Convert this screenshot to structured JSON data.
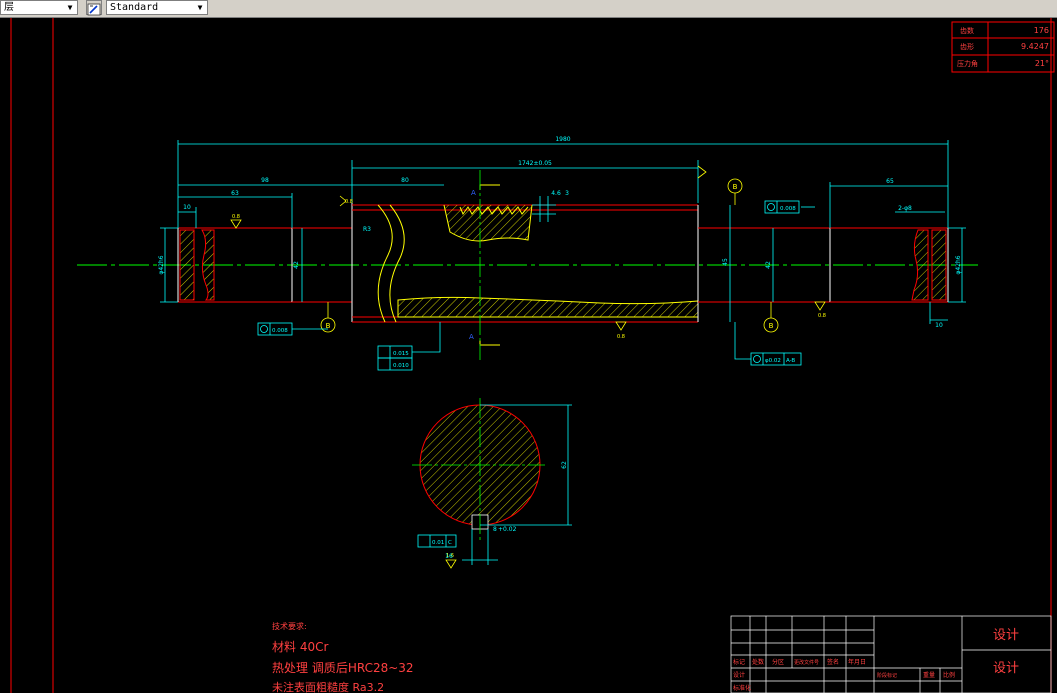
{
  "toolbar": {
    "layer_combo_value": "层",
    "text_style_combo_value": "Standard",
    "text_style_icon": "text-style-icon",
    "dropdown_icon": "chevron-down-icon"
  },
  "colors": {
    "background": "#000000",
    "frame": "#ff0000",
    "dimension": "#00ffff",
    "centerline": "#00ff00",
    "outline": "#ffffff",
    "hatch": "#ffff00",
    "part_edge": "#ff0000",
    "annotation_text": "#ff0000"
  },
  "param_table": {
    "rows": [
      {
        "label": "齿数",
        "value": "176"
      },
      {
        "label": "齿形",
        "value": "9.4247"
      },
      {
        "label": "压力角",
        "value": "21°"
      }
    ]
  },
  "dimensions": {
    "overall_length": "1980",
    "length_1742": "1742±0.05",
    "left_63": "63",
    "left_98": "98",
    "left_10": "10",
    "mid_80": "80",
    "right_65": "65",
    "right_10": "10",
    "groove": "2-φ8",
    "dia_left": "φ42h6",
    "dia_left_shoulder": "42",
    "dia_right_shoulder": "42",
    "dia_right": "φ42h6",
    "dia_center": "45",
    "section_dia": "62",
    "keyway_depth": "8",
    "keyway_tol": "+0.02",
    "keyway_width": "16",
    "tooth_dim_a": "4.6",
    "tooth_dim_b": "3",
    "radius_r3": "R3",
    "rough_08_a": "0.8",
    "rough_08_b": "0.8",
    "rough_08_c": "0.8",
    "rough_08_d": "0.8",
    "rough_16": "1.6",
    "rough_32": "3.2",
    "section_label_a_top": "A",
    "section_label_a_bottom": "A",
    "datum_b_left": "B",
    "datum_b_right": "B",
    "datum_b_top": "B"
  },
  "tolerances": {
    "runout_left": "0.008",
    "runout_right": "0.008",
    "cyl_a": "0.015",
    "cyl_b": "0.010",
    "sym_value": "φ0.02",
    "sym_datum": "A-B",
    "key_sym": "0.01",
    "key_datum": "C"
  },
  "notes": {
    "heading": "技术要求:",
    "line1": "材料  40Cr",
    "line2": "热处理   调质后HRC28~32",
    "line3": "未注表面粗糙度 Ra3.2"
  },
  "title_block": {
    "design_top": "设计",
    "design_bottom": "设计",
    "row_labels": [
      "标记",
      "处数",
      "分区",
      "更改文件号",
      "签名",
      "年月日"
    ],
    "lower_labels": [
      "设计",
      "标准化"
    ],
    "stage_labels": [
      "阶段标记",
      "重量",
      "比例"
    ]
  }
}
